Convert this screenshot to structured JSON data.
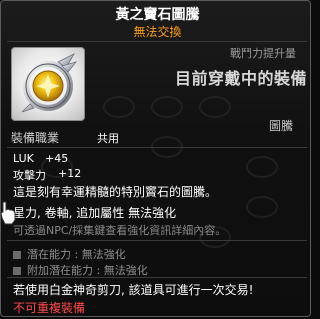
{
  "item": {
    "name": "黃之竇石圖騰",
    "trade_status": "無法交換",
    "power_label": "戰鬥力提升量",
    "power_text": "目前穿戴中的裝備",
    "job_label": "裝備職業",
    "job_value": "共用",
    "type": "圖騰",
    "icon": "yellow-gem-totem-icon"
  },
  "stats": [
    {
      "name": "LUK",
      "value": "+45"
    },
    {
      "name": "攻擊力",
      "value": "+12"
    }
  ],
  "description": {
    "line1": "這是刻有幸運精髓的特別竇石的圖騰。",
    "line2": "星力, 卷軸, 追加屬性 無法強化",
    "line3": "可透過NPC/採集鍵查看強化資訊詳細內容。"
  },
  "potentials": [
    {
      "label": "潛在能力 : 無法強化"
    },
    {
      "label": "附加潛在能力 : 無法強化"
    }
  ],
  "notices": {
    "scissors": "若使用白金神奇剪刀, 該道具可進行一次交易!",
    "no_equip": "不可重複裝備"
  },
  "colors": {
    "title": "#ffffff",
    "trade": "#ff9c1e",
    "warning": "#ff4a4a"
  }
}
